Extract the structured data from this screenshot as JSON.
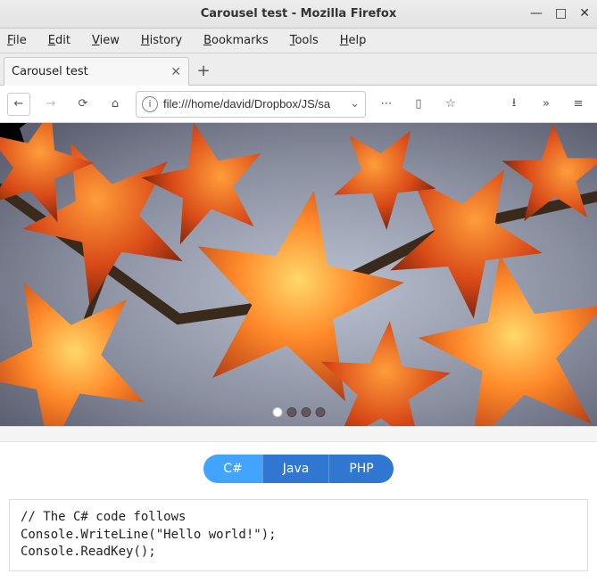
{
  "window": {
    "title": "Carousel test - Mozilla Firefox",
    "min": "—",
    "max": "□",
    "close": "✕"
  },
  "menubar": {
    "file": "File",
    "edit": "Edit",
    "view": "View",
    "history": "History",
    "bookmarks": "Bookmarks",
    "tools": "Tools",
    "help": "Help"
  },
  "tabs": {
    "active_label": "Carousel test",
    "close": "✕",
    "newtab": "+"
  },
  "nav": {
    "back": "←",
    "forward": "→",
    "reload": "⟳",
    "home": "⌂",
    "info": "i",
    "url": "file:///home/david/Dropbox/JS/sa",
    "chevron": "⌄",
    "more": "⋯",
    "reader": "▯",
    "star": "☆",
    "download": "⭳",
    "overflow": "»",
    "menu": "≡"
  },
  "carousel": {
    "slides": 4,
    "active_index": 0
  },
  "codetabs": {
    "items": [
      "C#",
      "Java",
      "PHP"
    ],
    "active_index": 0
  },
  "code": {
    "line1": "// The C# code follows",
    "line2": "Console.WriteLine(\"Hello world!\");",
    "line3": "Console.ReadKey();"
  }
}
